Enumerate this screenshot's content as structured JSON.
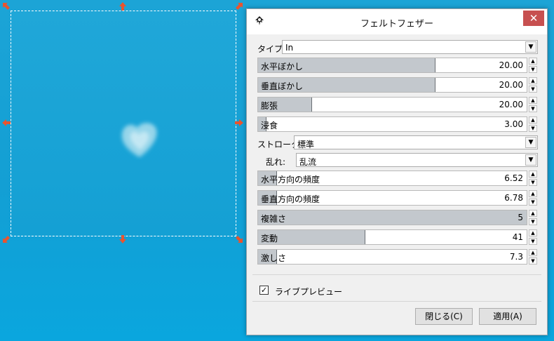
{
  "dialog": {
    "title": "フェルトフェザー",
    "close_glyph": "✕",
    "type_label": "タイプ:",
    "type_value": "In",
    "stroke_label": "ストローク:",
    "stroke_value": "標準",
    "turbulence_label": "乱れ:",
    "turbulence_value": "乱流",
    "sliders": [
      {
        "name": "水平ぼかし",
        "value": "20.00",
        "fraction": 0.66
      },
      {
        "name": "垂直ぼかし",
        "value": "20.00",
        "fraction": 0.66
      },
      {
        "name": "膨張",
        "value": "20.00",
        "fraction": 0.2
      },
      {
        "name": "浸食",
        "value": "3.00",
        "fraction": 0.03
      },
      {
        "name": "水平方向の頻度",
        "value": "6.52",
        "fraction": 0.07
      },
      {
        "name": "垂直方向の頻度",
        "value": "6.78",
        "fraction": 0.07
      },
      {
        "name": "複雑さ",
        "value": "5",
        "fraction": 1.0
      },
      {
        "name": "変動",
        "value": "41",
        "fraction": 0.4
      },
      {
        "name": "激しさ",
        "value": "7.3",
        "fraction": 0.07
      }
    ],
    "live_preview_label": "ライブプレビュー",
    "live_preview_checked": true,
    "close_button": "閉じる(C)",
    "apply_button": "適用(A)"
  },
  "colors": {
    "canvas": "#1ca4d6",
    "handle": "#e8542f",
    "close_button": "#c75050"
  }
}
